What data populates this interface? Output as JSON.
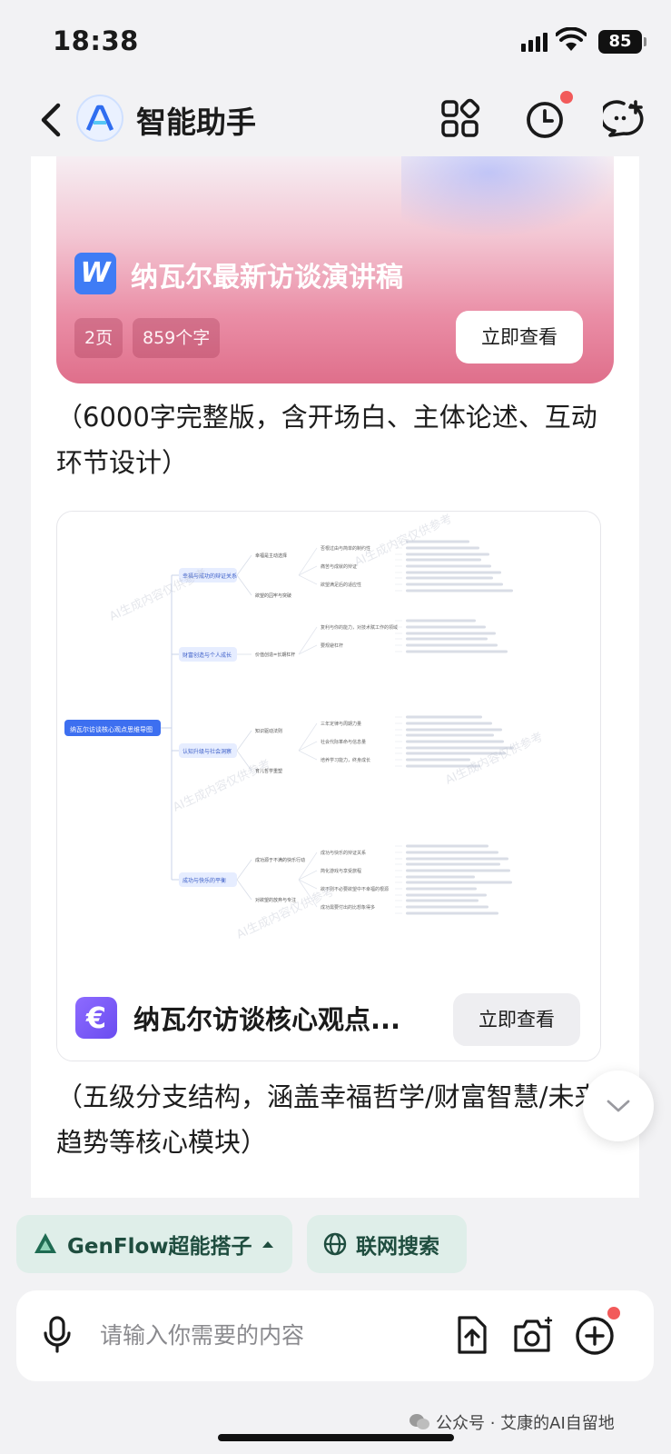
{
  "status_bar": {
    "time": "18:38",
    "battery": "85"
  },
  "header": {
    "title": "智能助手"
  },
  "doc_card": {
    "title": "纳瓦尔最新访谈演讲稿",
    "pages": "2页",
    "chars": "859个字",
    "button": "立即查看"
  },
  "message1": "（6000字完整版，含开场白、主体论述、互动环节设计）",
  "mindmap_card": {
    "title": "纳瓦尔访谈核心观点...",
    "button": "立即查看",
    "watermark": "AI生成内容仅供参考",
    "root": "纳瓦尔访谈核心观点思维导图",
    "branches": [
      {
        "label": "幸福与成功的辩证关系",
        "nodes": [
          "幸福是主动选择",
          "欲望的囚牢与突破"
        ],
        "leaves": [
          "否根过由与简单的制约性",
          "痛苦与成就的辩证",
          "欲望满足后的适应性"
        ]
      },
      {
        "label": "财富创造与个人成长",
        "nodes": [
          "价值创造=长期杠杆"
        ],
        "leaves": [
          "复利与你的能力，对技术赋工作的领域",
          "要规避杠杆"
        ]
      },
      {
        "label": "认知升级与社会洞察",
        "nodes": [
          "知识驱动法则",
          "育儿哲学重塑"
        ],
        "leaves": [
          "三年定律与周期力量",
          "社会代际革命与信息量",
          "培养学习能力，终身成长"
        ]
      },
      {
        "label": "成功与快乐的平衡",
        "nodes": [
          "成功源于不满的快乐行动",
          "对欲望的放弃与专注"
        ],
        "leaves": [
          "成功与快乐的辩证关系",
          "简化游戏与享受旅程",
          "欲不则不必要欲望中不幸福的根源",
          "成功需要付出的比想象得多"
        ]
      }
    ]
  },
  "message2": "（五级分支结构，涵盖幸福哲学/财富智慧/未来趋势等核心模块）",
  "pills": {
    "genflow": "GenFlow超能搭子",
    "search": "联网搜索"
  },
  "input": {
    "placeholder": "请输入你需要的内容"
  },
  "footnote": "公众号 · 艾康的AI自留地"
}
